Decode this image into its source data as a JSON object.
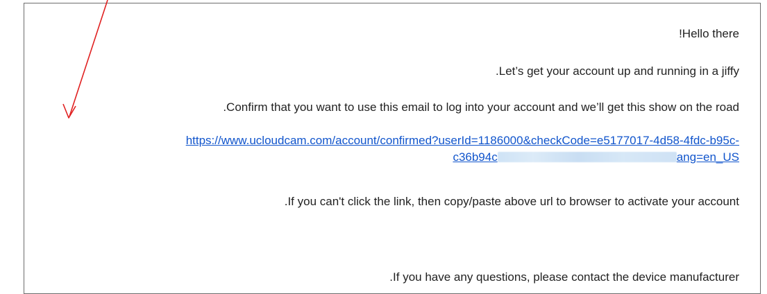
{
  "email": {
    "greeting": "!Hello there",
    "intro": ".Let’s get your account up and running in a jiffy",
    "confirm_text": ".Confirm that you want to use this email to log into your account and we’ll get this show on the road",
    "link_part1": "https://www.ucloudcam.com/account/confirmed?userId=1186000&checkCode=e5177017-4d58-4fdc-b95c-",
    "link_part2_start": "c36b94c",
    "link_part2_end": "ang=en_US",
    "fallback_text": ".If you can't click the link, then copy/paste above url to browser to activate your account",
    "contact_text": ".If you have any questions, please contact the device manufacturer"
  },
  "annotation": {
    "arrow_color": "#e02020"
  },
  "colors": {
    "link": "#1155cc",
    "text": "#222222",
    "border": "#6b6b6b"
  }
}
